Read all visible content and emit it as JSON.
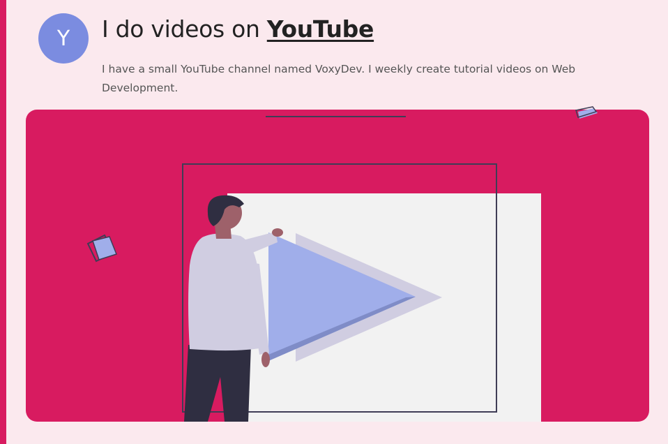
{
  "header": {
    "avatar_initial": "Y",
    "title_prefix": "I do videos on ",
    "title_link": "YouTube",
    "description": "I have a small YouTube channel named VoxyDev. I weekly create tutorial videos on Web Development."
  },
  "colors": {
    "accent": "#d81b60",
    "background": "#fbe9ee",
    "avatar": "#7b8ce0",
    "play_triangle": "#a0aeea",
    "screen": "#f2f2f2",
    "outline": "#3f3d56",
    "person_pants": "#2f2e41",
    "person_shirt": "#d0cde1"
  },
  "illustration": {
    "icons": [
      "play-triangle-icon",
      "video-screen-icon",
      "floating-square-icon"
    ]
  }
}
